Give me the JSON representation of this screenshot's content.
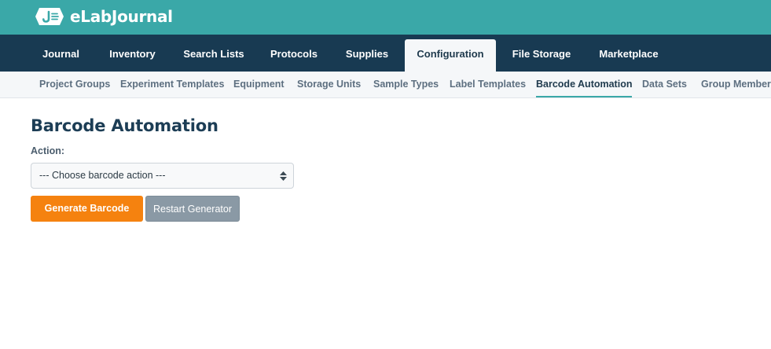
{
  "brand": {
    "name": "eLabJournal",
    "logo_mark": "J",
    "color": "#3aa8a8"
  },
  "main_nav": {
    "tabs": [
      {
        "label": "Journal",
        "active": false
      },
      {
        "label": "Inventory",
        "active": false
      },
      {
        "label": "Search Lists",
        "active": false
      },
      {
        "label": "Protocols",
        "active": false
      },
      {
        "label": "Supplies",
        "active": false
      },
      {
        "label": "Configuration",
        "active": true
      },
      {
        "label": "File Storage",
        "active": false
      },
      {
        "label": "Marketplace",
        "active": false
      }
    ]
  },
  "sub_nav": {
    "tabs": [
      {
        "label": "Project Groups",
        "active": false
      },
      {
        "label": "Experiment Templates",
        "active": false
      },
      {
        "label": "Equipment",
        "active": false
      },
      {
        "label": "Storage Units",
        "active": false
      },
      {
        "label": "Sample Types",
        "active": false
      },
      {
        "label": "Label Templates",
        "active": false
      },
      {
        "label": "Barcode Automation",
        "active": true
      },
      {
        "label": "Data Sets",
        "active": false
      },
      {
        "label": "Group Members",
        "active": false
      }
    ]
  },
  "page": {
    "title": "Barcode Automation",
    "action_label": "Action:",
    "action_select": {
      "selected": "--- Choose barcode action ---",
      "icon": "sort-arrows-icon"
    },
    "generate_button": "Generate Barcode",
    "restart_button": "Restart Generator"
  },
  "colors": {
    "brand_bar": "#3aa8a8",
    "nav_bar": "#183a52",
    "primary_button": "#f5820f",
    "secondary_button": "#8a99a5"
  }
}
